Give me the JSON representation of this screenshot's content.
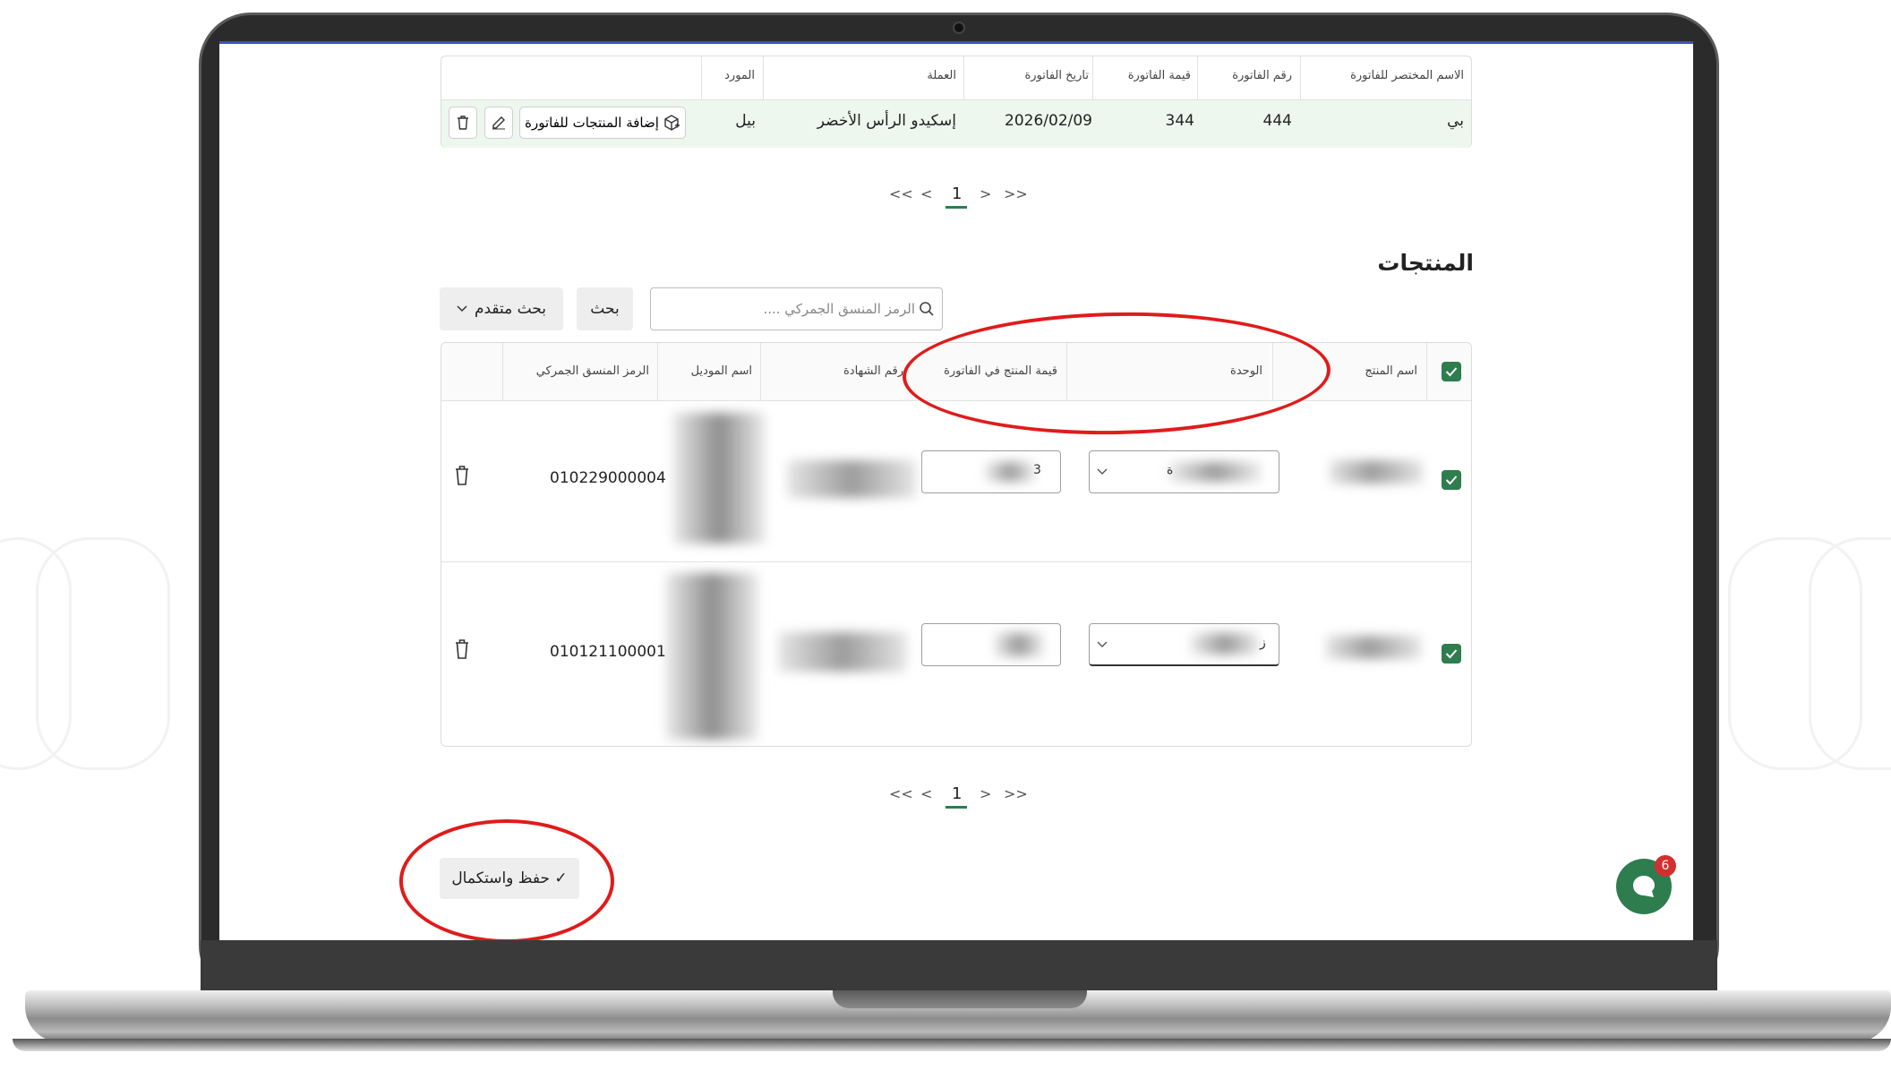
{
  "invoices_table": {
    "headers": {
      "short_name": "الاسم المختصر للفاتورة",
      "number": "رقم الفاتورة",
      "value": "قيمة الفاتورة",
      "date": "تاريخ الفاتورة",
      "currency": "العملة",
      "supplier": "المورد"
    },
    "row": {
      "short_name": "بي",
      "number": "444",
      "value": "344",
      "date": "2026/02/09",
      "currency": "إسكيدو الرأس الأخضر",
      "supplier": "بيل",
      "add_products_label": "إضافة المنتجات للفاتورة"
    }
  },
  "pagination_top": {
    "first": "<<",
    "prev": "<",
    "page": "1",
    "next": ">",
    "last": ">>"
  },
  "products": {
    "title": "المنتجات",
    "search_placeholder": "الرمز المنسق الجمركي ....",
    "search_button": "بحث",
    "advanced_search_button": "بحث متقدم",
    "headers": {
      "product_name": "اسم المنتج",
      "unit": "الوحدة",
      "product_value": "قيمة المنتج في الفاتورة",
      "certificate": "رقم الشهادة",
      "model_name": "اسم الموديل",
      "hs_code": "الرمز المنسق الجمركي"
    },
    "rows": [
      {
        "hs_code": "010229000004",
        "value_partial": "3",
        "unit_partial": "ة"
      },
      {
        "hs_code": "010121100001",
        "value_partial": "",
        "unit_partial": "ز"
      }
    ]
  },
  "pagination_bottom": {
    "first": "<<",
    "prev": "<",
    "page": "1",
    "next": ">",
    "last": ">>"
  },
  "save_button": "✓ حفظ واستكمال",
  "chat": {
    "badge": "6"
  },
  "colors": {
    "accent_green": "#2e7d4f",
    "row_highlight": "#edf7ee",
    "annotation_red": "#e01b1b",
    "badge_red": "#d32f2f"
  }
}
